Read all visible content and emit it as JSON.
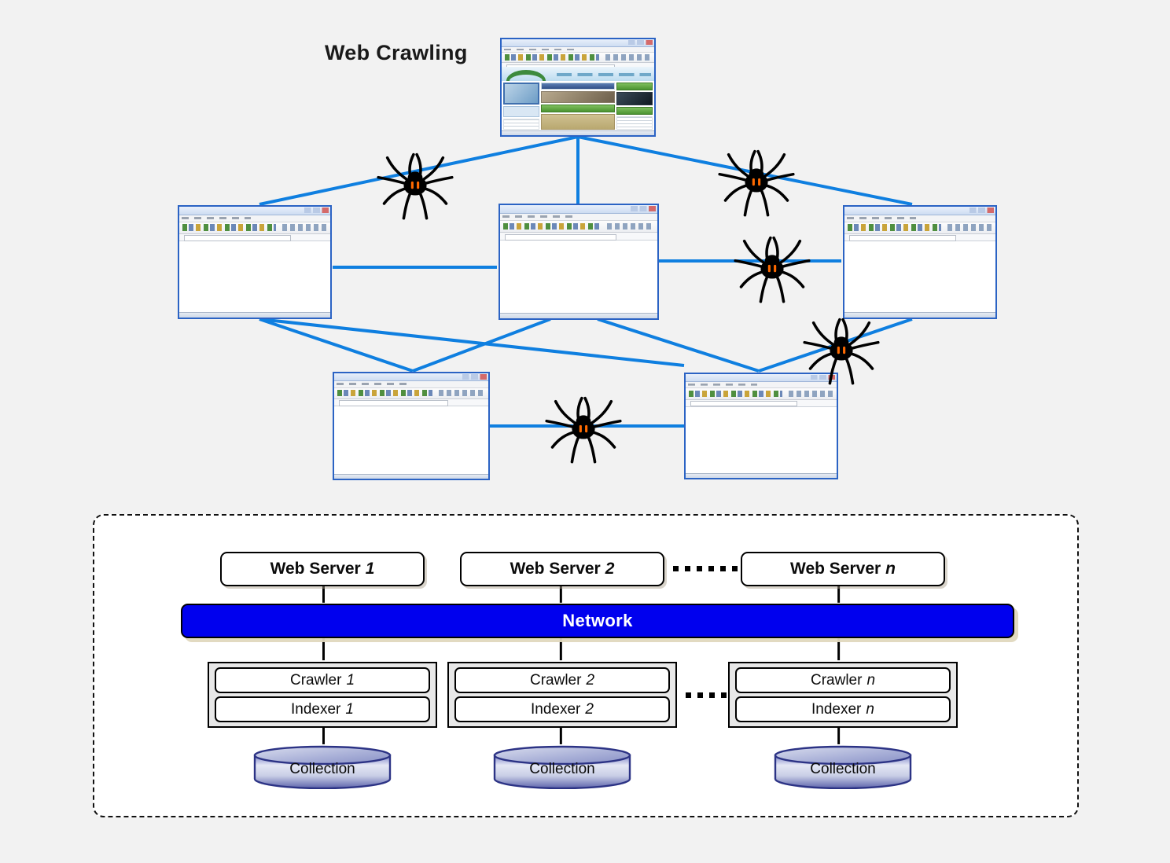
{
  "page": {
    "title": "Web Crawling",
    "background_color": "#f2f2f2"
  },
  "colors": {
    "edge_blue": "#0f7fe0",
    "network_blue": "#0000ee",
    "network_text": "#ffffff",
    "thumb_border": "#2b63c4",
    "panel_border": "#111111",
    "cylinder_blue": "#3a3f9e",
    "spider_body": "#000000",
    "spider_marking": "#ff6a00"
  },
  "web_graph": {
    "label": "Web Crawling",
    "nodes": [
      {
        "id": "site-top",
        "name": "web-page-thumbnail-top",
        "style": "green"
      },
      {
        "id": "site-mid-left",
        "name": "web-page-thumbnail-mid-left",
        "style": "blue-yellow"
      },
      {
        "id": "site-mid-center",
        "name": "web-page-thumbnail-mid-center",
        "style": "blue-pink"
      },
      {
        "id": "site-mid-right",
        "name": "web-page-thumbnail-mid-right",
        "style": "blue-pink"
      },
      {
        "id": "site-bottom-left",
        "name": "web-page-thumbnail-bottom-left",
        "style": "blue-pink"
      },
      {
        "id": "site-bottom-right",
        "name": "web-page-thumbnail-bottom-right",
        "style": "blue-yellow"
      }
    ],
    "spiders": [
      {
        "id": "spider-1",
        "name": "crawler-spider-upper-left"
      },
      {
        "id": "spider-2",
        "name": "crawler-spider-upper-right"
      },
      {
        "id": "spider-3",
        "name": "crawler-spider-middle-right"
      },
      {
        "id": "spider-4",
        "name": "crawler-spider-lower-right"
      },
      {
        "id": "spider-5",
        "name": "crawler-spider-bottom-center"
      }
    ],
    "edge_count": 11
  },
  "architecture": {
    "network_label": "Network",
    "ellipsis_symbol": "·······",
    "servers": [
      {
        "label": "Web Server",
        "number": "1"
      },
      {
        "label": "Web Server",
        "number": "2"
      },
      {
        "label": "Web Server",
        "number": "n"
      }
    ],
    "nodes": [
      {
        "crawler_label": "Crawler",
        "crawler_number": "1",
        "indexer_label": "Indexer",
        "indexer_number": "1",
        "collection_label": "Collection"
      },
      {
        "crawler_label": "Crawler",
        "crawler_number": "2",
        "indexer_label": "Indexer",
        "indexer_number": "2",
        "collection_label": "Collection"
      },
      {
        "crawler_label": "Crawler",
        "crawler_number": "n",
        "indexer_label": "Indexer",
        "indexer_number": "n",
        "collection_label": "Collection"
      }
    ]
  }
}
